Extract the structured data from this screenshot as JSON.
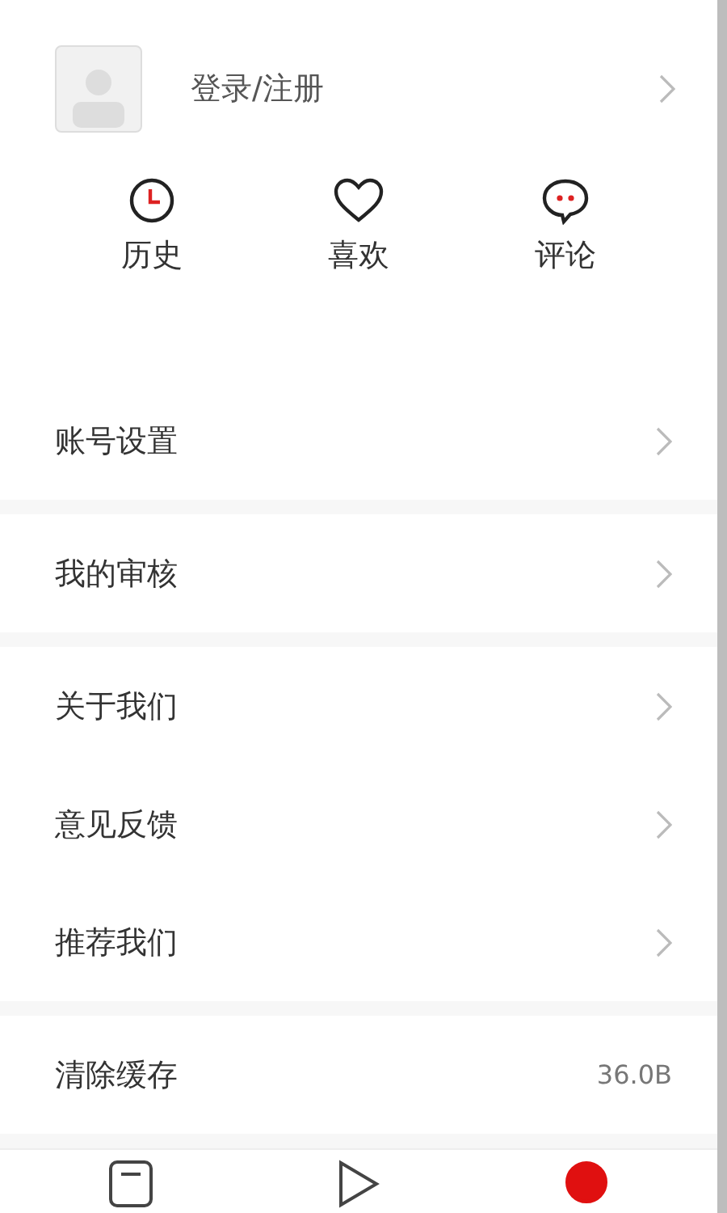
{
  "profile": {
    "login_label": "登录/注册"
  },
  "shortcuts": [
    {
      "kind": "history",
      "label": "历史"
    },
    {
      "kind": "favorite",
      "label": "喜欢"
    },
    {
      "kind": "comment",
      "label": "评论"
    }
  ],
  "sections": [
    {
      "items": [
        {
          "label": "账号设置"
        }
      ]
    },
    {
      "items": [
        {
          "label": "我的审核"
        }
      ]
    },
    {
      "items": [
        {
          "label": "关于我们"
        },
        {
          "label": "意见反馈"
        },
        {
          "label": "推荐我们"
        }
      ]
    },
    {
      "items": [
        {
          "label": "清除缓存",
          "value": "36.0B"
        }
      ]
    }
  ],
  "tab_bar": [
    {
      "kind": "document",
      "selected": false
    },
    {
      "kind": "play",
      "selected": false
    },
    {
      "kind": "profile",
      "selected": true
    }
  ]
}
